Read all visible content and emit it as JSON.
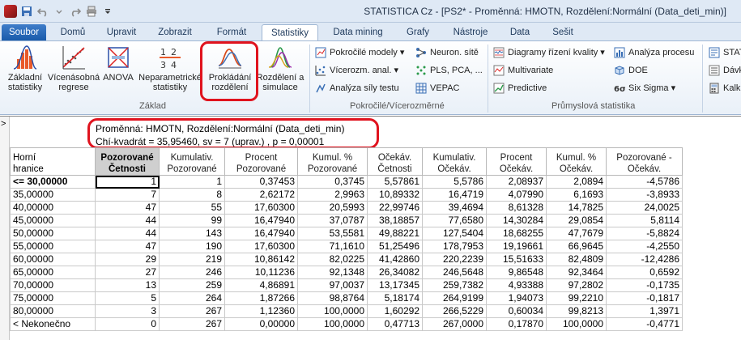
{
  "window": {
    "title": "STATISTICA Cz - [PS2* - Proměnná: HMOTN, Rozdělení:Normální (Data_deti_min)]"
  },
  "tabs": [
    "Soubor",
    "Domů",
    "Upravit",
    "Zobrazit",
    "Formát",
    "Statistiky",
    "Data mining",
    "Grafy",
    "Nástroje",
    "Data",
    "Sešit"
  ],
  "active_tab": "Statistiky",
  "ribbon": {
    "zaklad": {
      "label": "Základ",
      "buttons": [
        {
          "l1": "Základní",
          "l2": "statistiky",
          "icon": "histogram-curve-icon"
        },
        {
          "l1": "Vícenásobná",
          "l2": "regrese",
          "icon": "scatter-regression-icon"
        },
        {
          "l1": "ANOVA",
          "l2": "",
          "icon": "anova-icon"
        },
        {
          "l1": "Neparametrické",
          "l2": "statistiky",
          "icon": "nonparametric-icon"
        },
        {
          "l1": "Prokládání",
          "l2": "rozdělení",
          "icon": "distribution-fit-icon"
        },
        {
          "l1": "Rozdělení a",
          "l2": "simulace",
          "icon": "simulation-icon"
        }
      ]
    },
    "advanced": {
      "label": "Pokročilé/Vícerozměrné",
      "items": [
        {
          "label": "Pokročilé modely ▾",
          "icon": "models-icon"
        },
        {
          "label": "Neuron. sítě",
          "icon": "neural-net-icon"
        },
        {
          "label": "Vícerozm. anal. ▾",
          "icon": "multivariate-analysis-icon"
        },
        {
          "label": "PLS, PCA, ...",
          "icon": "pls-pca-icon"
        },
        {
          "label": "Analýza síly testu",
          "icon": "power-analysis-icon"
        },
        {
          "label": "VEPAC",
          "icon": "vepac-icon"
        }
      ]
    },
    "industrial": {
      "label": "Průmyslová statistika",
      "items": [
        {
          "label": "Diagramy řízení kvality ▾",
          "icon": "control-chart-icon"
        },
        {
          "label": "Analýza procesu",
          "icon": "process-analysis-icon"
        },
        {
          "label": "Multivariate",
          "icon": "multivariate-icon"
        },
        {
          "label": "DOE",
          "icon": "doe-icon"
        },
        {
          "label": "Predictive",
          "icon": "predictive-icon"
        },
        {
          "label": "Six Sigma ▾",
          "icon": "six-sigma-icon"
        }
      ]
    },
    "cut": {
      "items": [
        {
          "label": "STAT",
          "icon": "stat-icon"
        },
        {
          "label": "Dávk",
          "icon": "batch-icon"
        },
        {
          "label": "Kalk",
          "icon": "calc-icon"
        }
      ]
    }
  },
  "pane": {
    "marker": ">",
    "info_line1": "Proměnná: HMOTN, Rozdělení:Normální (Data_deti_min)",
    "info_line2": "Chí-kvadrát = 35,95460, sv = 7 (uprav.) , p = 0,00001"
  },
  "table": {
    "headers": [
      [
        "Horní",
        "hranice"
      ],
      [
        "Pozorované",
        "Četnosti"
      ],
      [
        "Kumulativ.",
        "Pozorované"
      ],
      [
        "Procent",
        "Pozorované"
      ],
      [
        "Kumul. %",
        "Pozorované"
      ],
      [
        "Očekáv.",
        "Četnosti"
      ],
      [
        "Kumulativ.",
        "Očekáv."
      ],
      [
        "Procent",
        "Očekáv."
      ],
      [
        "Kumul. %",
        "Očekáv."
      ],
      [
        "Pozorované -",
        "Očekáv."
      ]
    ],
    "rows": [
      [
        "<= 30,00000",
        "1",
        "1",
        "0,37453",
        "0,3745",
        "5,57861",
        "5,5786",
        "2,08937",
        "2,0894",
        "-4,5786"
      ],
      [
        "35,00000",
        "7",
        "8",
        "2,62172",
        "2,9963",
        "10,89332",
        "16,4719",
        "4,07990",
        "6,1693",
        "-3,8933"
      ],
      [
        "40,00000",
        "47",
        "55",
        "17,60300",
        "20,5993",
        "22,99746",
        "39,4694",
        "8,61328",
        "14,7825",
        "24,0025"
      ],
      [
        "45,00000",
        "44",
        "99",
        "16,47940",
        "37,0787",
        "38,18857",
        "77,6580",
        "14,30284",
        "29,0854",
        "5,8114"
      ],
      [
        "50,00000",
        "44",
        "143",
        "16,47940",
        "53,5581",
        "49,88221",
        "127,5404",
        "18,68255",
        "47,7679",
        "-5,8824"
      ],
      [
        "55,00000",
        "47",
        "190",
        "17,60300",
        "71,1610",
        "51,25496",
        "178,7953",
        "19,19661",
        "66,9645",
        "-4,2550"
      ],
      [
        "60,00000",
        "29",
        "219",
        "10,86142",
        "82,0225",
        "41,42860",
        "220,2239",
        "15,51633",
        "82,4809",
        "-12,4286"
      ],
      [
        "65,00000",
        "27",
        "246",
        "10,11236",
        "92,1348",
        "26,34082",
        "246,5648",
        "9,86548",
        "92,3464",
        "0,6592"
      ],
      [
        "70,00000",
        "13",
        "259",
        "4,86891",
        "97,0037",
        "13,17345",
        "259,7382",
        "4,93388",
        "97,2802",
        "-0,1735"
      ],
      [
        "75,00000",
        "5",
        "264",
        "1,87266",
        "98,8764",
        "5,18174",
        "264,9199",
        "1,94073",
        "99,2210",
        "-0,1817"
      ],
      [
        "80,00000",
        "3",
        "267",
        "1,12360",
        "100,0000",
        "1,60292",
        "266,5229",
        "0,60034",
        "99,8213",
        "1,3971"
      ],
      [
        "< Nekonečno",
        "0",
        "267",
        "0,00000",
        "100,0000",
        "0,47713",
        "267,0000",
        "0,17870",
        "100,0000",
        "-0,4771"
      ]
    ]
  },
  "colors": {
    "highlight": "#e0131e",
    "ribbon_bg": "#dfe9f5",
    "soubor_tab": "#1a5bab"
  }
}
